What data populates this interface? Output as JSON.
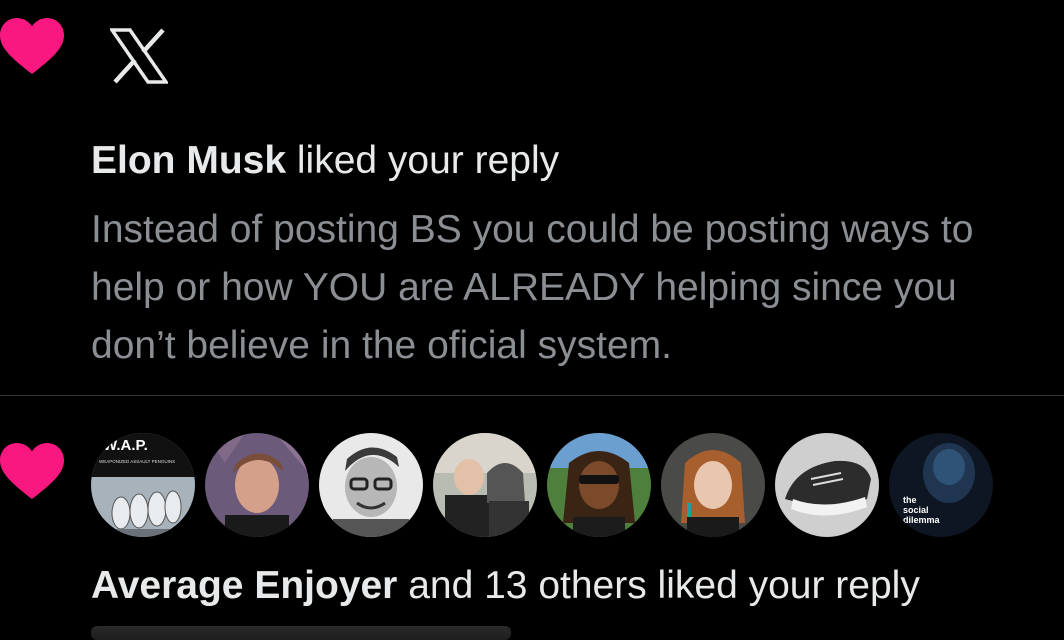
{
  "notifications": [
    {
      "user": "Elon Musk",
      "action": " liked your reply",
      "reply_text": "Instead of posting BS you could be posting ways to help or how YOU are ALREADY helping since you don’t believe in the oficial system."
    },
    {
      "user": "Average Enjoyer",
      "action": " and 13 others liked your reply"
    }
  ],
  "avatars": [
    {
      "label_top": "W.A.P.",
      "label_sub": "WEAPONIZED ASSAULT PENGUINS"
    },
    {
      "label": ""
    },
    {
      "label": ""
    },
    {
      "label": ""
    },
    {
      "label": ""
    },
    {
      "label": ""
    },
    {
      "label": ""
    },
    {
      "label_lines": [
        "the",
        "social",
        "dilemma"
      ]
    }
  ],
  "colors": {
    "heart": "#f91880",
    "background": "#000000",
    "primary_text": "#e7e9ea",
    "secondary_text": "#8b8f94",
    "divider": "#2f3336"
  },
  "icons": {
    "heart": "heart-icon",
    "logo": "x-logo-icon"
  }
}
